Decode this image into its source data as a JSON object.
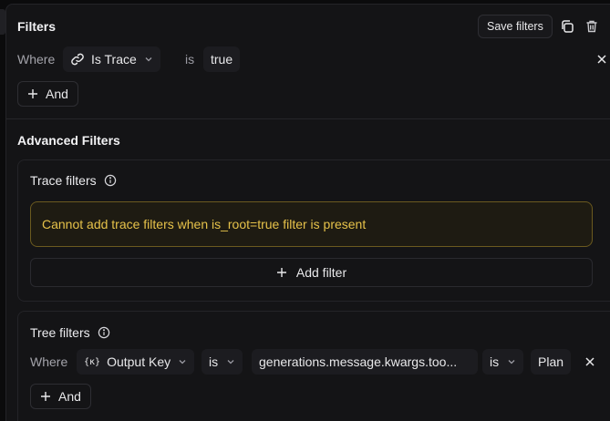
{
  "header": {
    "title": "Filters",
    "save_label": "Save filters",
    "icons": [
      "copy-icon",
      "trash-icon"
    ]
  },
  "basic_filter": {
    "where_label": "Where",
    "field": "Is Trace",
    "operator": "is",
    "value": "true"
  },
  "and_label": "And",
  "advanced": {
    "title": "Advanced Filters",
    "trace_filters": {
      "title": "Trace filters",
      "warning": "Cannot add trace filters when is_root=true filter is present",
      "add_filter_label": "Add filter"
    },
    "tree_filters": {
      "title": "Tree filters",
      "where_label": "Where",
      "field": "Output Key",
      "operator": "is",
      "key": "generations.message.kwargs.too...",
      "value_operator": "is",
      "value": "Plan",
      "and_label": "And"
    }
  },
  "colors": {
    "background": "#141416",
    "warning_text": "#e6c24a",
    "warning_border": "#6b5a1f"
  }
}
